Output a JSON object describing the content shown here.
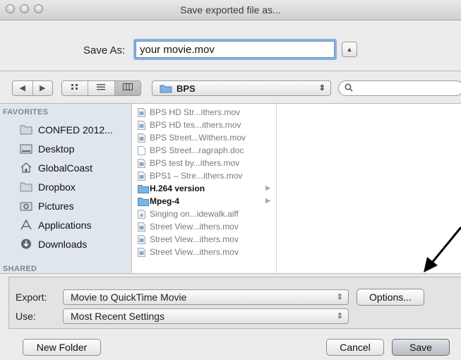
{
  "window": {
    "title": "Save exported file as..."
  },
  "save_as": {
    "label": "Save As:",
    "value": "your movie.mov"
  },
  "toolbar": {
    "back_icon": "back-arrow-icon",
    "forward_icon": "forward-arrow-icon",
    "location": "BPS",
    "view_icons": [
      "icon-view-icon",
      "list-view-icon",
      "column-view-icon"
    ]
  },
  "sidebar": {
    "favorites_header": "FAVORITES",
    "items": [
      {
        "label": "CONFED 2012...",
        "icon": "folder-icon"
      },
      {
        "label": "Desktop",
        "icon": "desktop-icon"
      },
      {
        "label": "GlobalCoast",
        "icon": "home-icon"
      },
      {
        "label": "Dropbox",
        "icon": "folder-icon"
      },
      {
        "label": "Pictures",
        "icon": "camera-icon"
      },
      {
        "label": "Applications",
        "icon": "applications-icon"
      },
      {
        "label": "Downloads",
        "icon": "downloads-icon"
      }
    ],
    "shared_header": "SHARED"
  },
  "files": [
    {
      "name": "BPS HD Str...ithers.mov",
      "type": "movie"
    },
    {
      "name": "BPS HD tes...ithers.mov",
      "type": "movie"
    },
    {
      "name": "BPS Street...Withers.mov",
      "type": "movie"
    },
    {
      "name": "BPS Street...ragraph.doc",
      "type": "doc"
    },
    {
      "name": "BPS test by...ithers.mov",
      "type": "movie"
    },
    {
      "name": "BPS1 – Stre...ithers.mov",
      "type": "movie"
    },
    {
      "name": "H.264 version",
      "type": "folder"
    },
    {
      "name": "Mpeg-4",
      "type": "folder"
    },
    {
      "name": "Singing on...idewalk.aiff",
      "type": "audio"
    },
    {
      "name": "Street View...ithers.mov",
      "type": "movie"
    },
    {
      "name": "Street View...ithers.mov",
      "type": "movie"
    },
    {
      "name": "Street View...ithers.mov",
      "type": "movie"
    }
  ],
  "export": {
    "label": "Export:",
    "value": "Movie to QuickTime Movie",
    "options_button": "Options..."
  },
  "use": {
    "label": "Use:",
    "value": "Most Recent Settings"
  },
  "buttons": {
    "new_folder": "New Folder",
    "cancel": "Cancel",
    "save": "Save"
  },
  "colors": {
    "focus_ring": "#7fb0f0",
    "sidebar_bg": "#e0e6ed",
    "folder": "#6fa7d9"
  }
}
